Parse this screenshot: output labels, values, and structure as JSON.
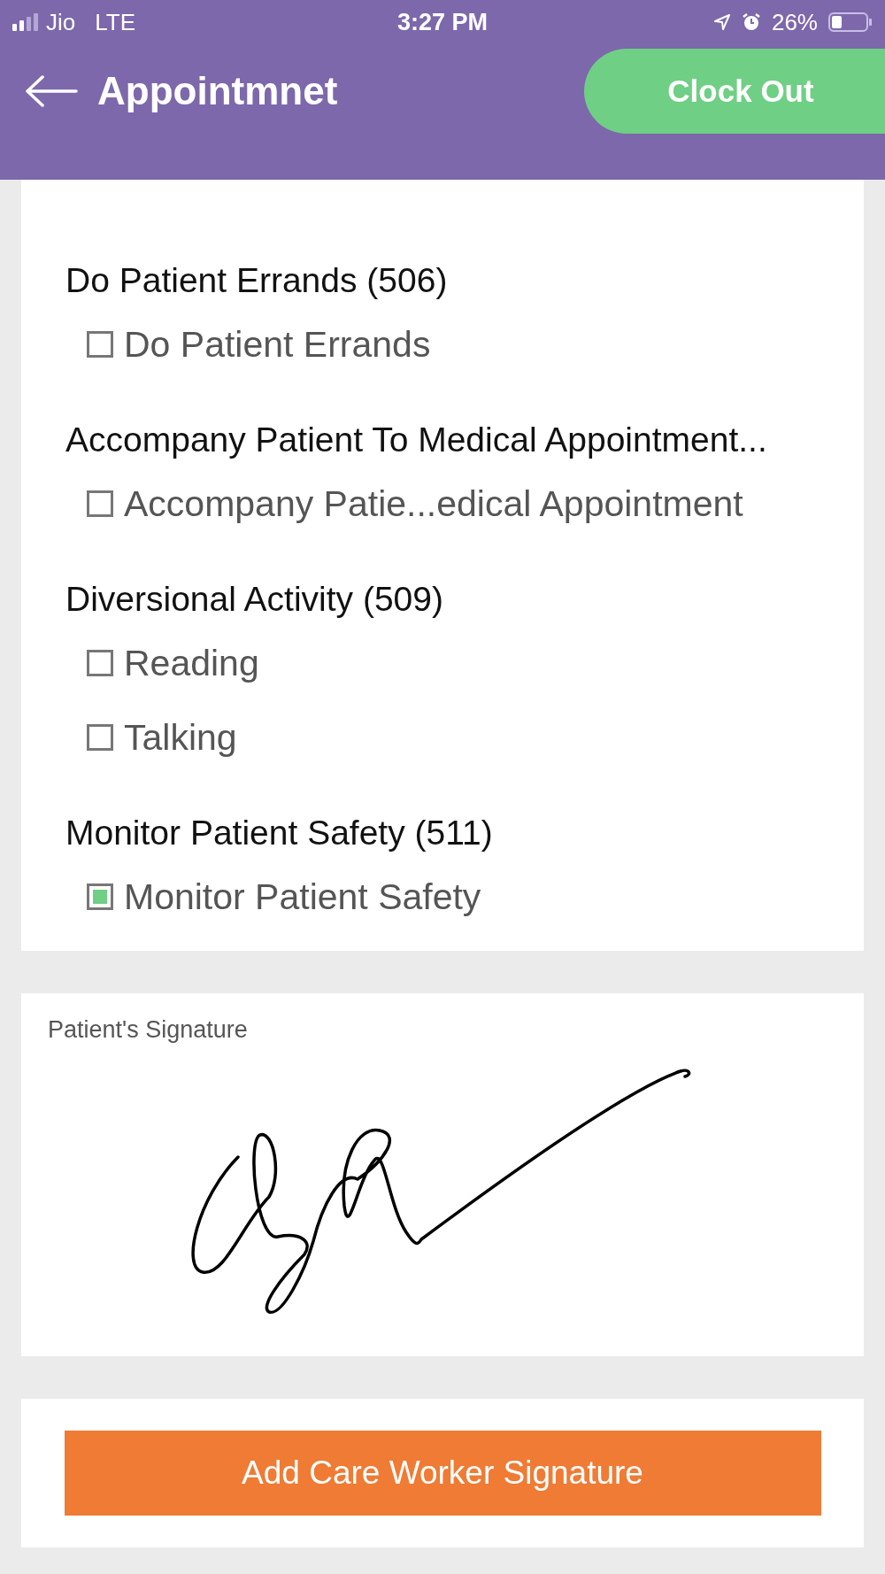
{
  "status_bar": {
    "carrier": "Jio",
    "network": "LTE",
    "time": "3:27 PM",
    "battery": "26%"
  },
  "header": {
    "title": "Appointmnet",
    "action": "Clock Out"
  },
  "tasks": [
    {
      "title": "Do Patient Errands (506)",
      "items": [
        {
          "label": "Do Patient Errands",
          "checked": false
        }
      ]
    },
    {
      "title": "Accompany Patient To Medical Appointment...",
      "items": [
        {
          "label": "Accompany Patie...edical Appointment",
          "checked": false
        }
      ]
    },
    {
      "title": "Diversional Activity (509)",
      "items": [
        {
          "label": "Reading",
          "checked": false
        },
        {
          "label": "Talking",
          "checked": false
        }
      ]
    },
    {
      "title": "Monitor Patient Safety (511)",
      "items": [
        {
          "label": "Monitor Patient Safety",
          "checked": true
        }
      ]
    }
  ],
  "signature": {
    "label": "Patient's Signature"
  },
  "button": "Add Care Worker Signature"
}
